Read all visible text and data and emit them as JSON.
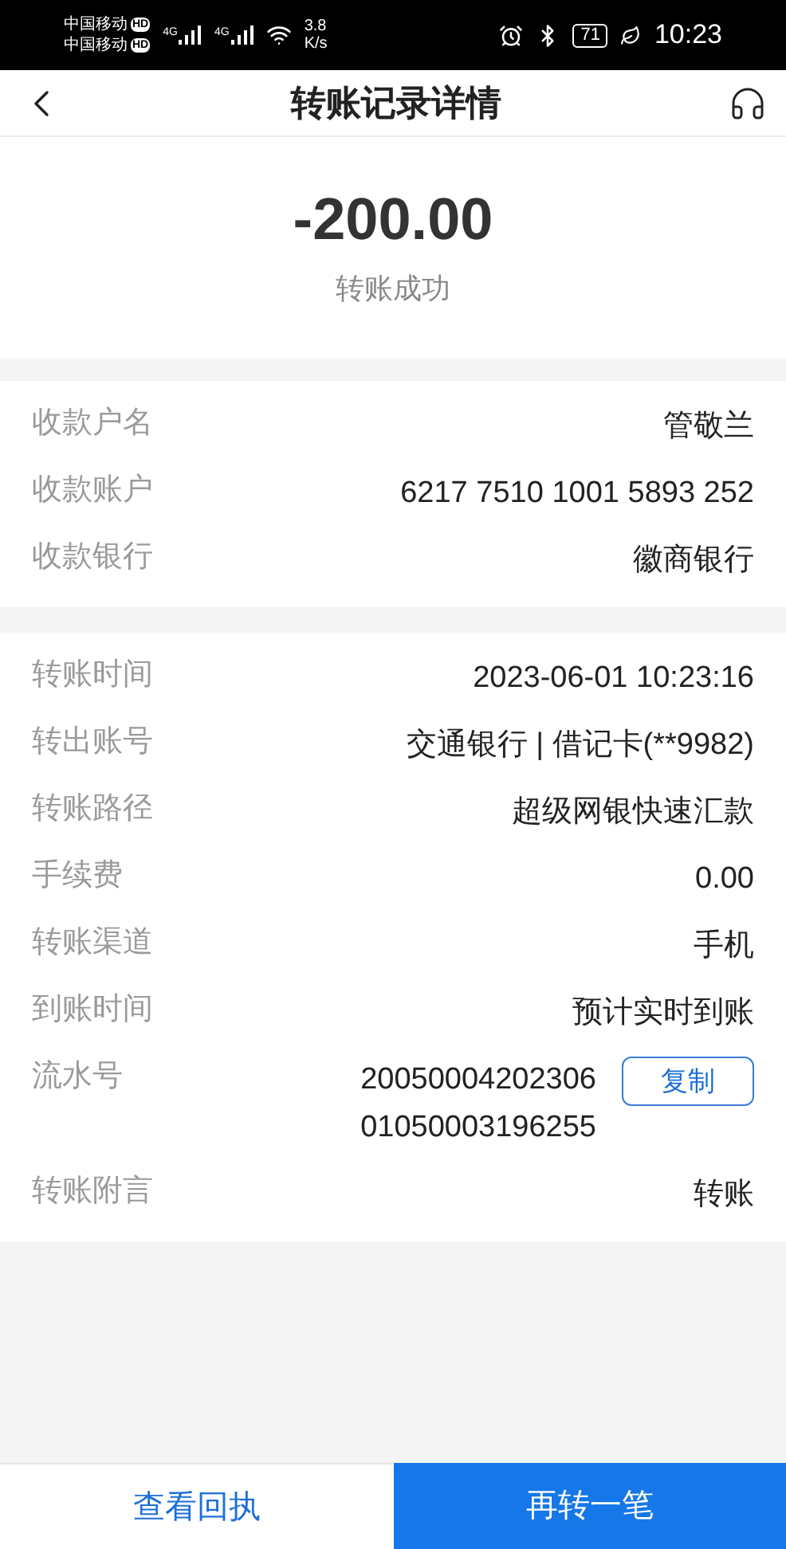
{
  "status_bar": {
    "carriers": [
      {
        "name": "中国移动",
        "badge": "HD"
      },
      {
        "name": "中国移动",
        "badge": "HD"
      }
    ],
    "signals": [
      "4G",
      "4G"
    ],
    "speed": "3.8",
    "speed_unit": "K/s",
    "battery": "71",
    "time": "10:23"
  },
  "header": {
    "title": "转账记录详情"
  },
  "amount": "-200.00",
  "status": "转账成功",
  "payee_rows": [
    {
      "label": "收款户名",
      "value": "管敬兰"
    },
    {
      "label": "收款账户",
      "value": "6217 7510 1001 5893 252"
    },
    {
      "label": "收款银行",
      "value": "徽商银行"
    }
  ],
  "detail_rows": [
    {
      "label": "转账时间",
      "value": "2023-06-01 10:23:16"
    },
    {
      "label": "转出账号",
      "value": "交通银行 | 借记卡(**9982)"
    },
    {
      "label": "转账路径",
      "value": "超级网银快速汇款"
    },
    {
      "label": "手续费",
      "value": "0.00"
    },
    {
      "label": "转账渠道",
      "value": "手机"
    },
    {
      "label": "到账时间",
      "value": "预计实时到账"
    },
    {
      "label": "流水号",
      "value": "2005000420230601050003196255",
      "action": "复制"
    },
    {
      "label": "转账附言",
      "value": "转账"
    }
  ],
  "bottom_buttons": [
    {
      "label": "查看回执",
      "kind": "secondary"
    },
    {
      "label": "再转一笔",
      "kind": "primary"
    }
  ]
}
